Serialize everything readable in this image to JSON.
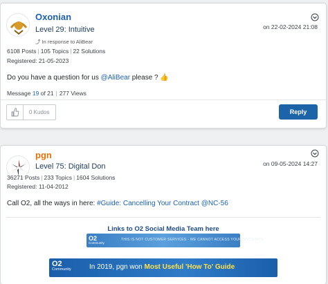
{
  "posts": [
    {
      "username": "Oxonian",
      "username_color": "#1a5fb4",
      "rank": "Level 29: Intuitive",
      "in_response_to": "In response to AliBear",
      "date": "on 22-02-2024 21:08",
      "posts_count": "6108 Posts",
      "topics_count": "105 Topics",
      "solutions_count": "22 Solutions",
      "registered": "Registered: 21-05-2023",
      "body_prefix": "Do you have a question for us ",
      "body_mention": "@AliBear",
      "body_suffix": " please ? 👍",
      "message_label": "Message ",
      "message_num": "19",
      "message_of": " of 21",
      "views": "277 Views",
      "kudos": "0 Kudos",
      "reply_label": "Reply"
    },
    {
      "username": "pgn",
      "username_color": "#e8710a",
      "rank": "Level 75: Digital Don",
      "date": "on 09-05-2024 14:27",
      "posts_count": "36271 Posts",
      "topics_count": "233 Topics",
      "solutions_count": "1604 Solutions",
      "registered": "Registered: 11-04-2012",
      "body_prefix": "Call O2, all the ways in here: ",
      "body_link": "#Guide: Cancelling Your Contract @NC-56",
      "signature_title": "Links to O2 Social Media Team here",
      "banner1_logo": "O2",
      "banner1_logo_sub": "Community",
      "banner1_text": "THIS IS NOT CUSTOMER SERVICES - WE CANNOT ACCESS YOUR ACCOUNTS",
      "banner2_logo": "O2",
      "banner2_logo_sub": "Community",
      "banner2_text_prefix": "In 2019, pgn won ",
      "banner2_text_highlight": "Most Useful 'How To' Guide"
    }
  ],
  "colors": {
    "accent": "#1c63a8",
    "link": "#1a5fb4"
  },
  "icons": [
    "menu-chevron-icon",
    "reply-arrow-icon",
    "thumbs-up-icon"
  ]
}
